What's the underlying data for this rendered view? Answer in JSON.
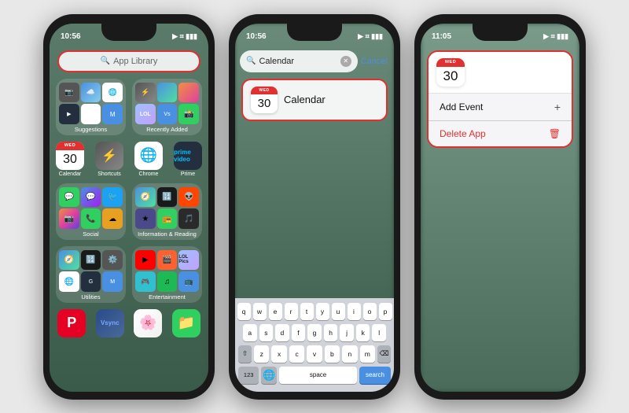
{
  "phone1": {
    "status_time": "10:56",
    "search_placeholder": "App Library",
    "folder1_label": "Suggestions",
    "folder2_label": "Recently Added",
    "folder3_label": "Social",
    "folder4_label": "Information & Reading",
    "folder5_label": "Utilities",
    "folder6_label": "Entertainment",
    "cal_day": "WED",
    "cal_num": "30"
  },
  "phone2": {
    "status_time": "10:56",
    "search_text": "Calendar",
    "cancel_label": "Cancel",
    "cal_day": "WED",
    "cal_num": "30",
    "cal_name": "Calendar",
    "kb_row1": [
      "q",
      "w",
      "e",
      "r",
      "t",
      "y",
      "u",
      "i",
      "o",
      "p"
    ],
    "kb_row2": [
      "a",
      "s",
      "d",
      "f",
      "g",
      "h",
      "j",
      "k",
      "l"
    ],
    "kb_row3": [
      "z",
      "x",
      "c",
      "v",
      "b",
      "n",
      "m"
    ],
    "kb_num": "123",
    "kb_space": "space",
    "kb_search": "search"
  },
  "phone3": {
    "status_time": "11:05",
    "cal_day": "WED",
    "cal_num": "30",
    "menu_add": "Add Event",
    "menu_delete": "Delete App"
  }
}
